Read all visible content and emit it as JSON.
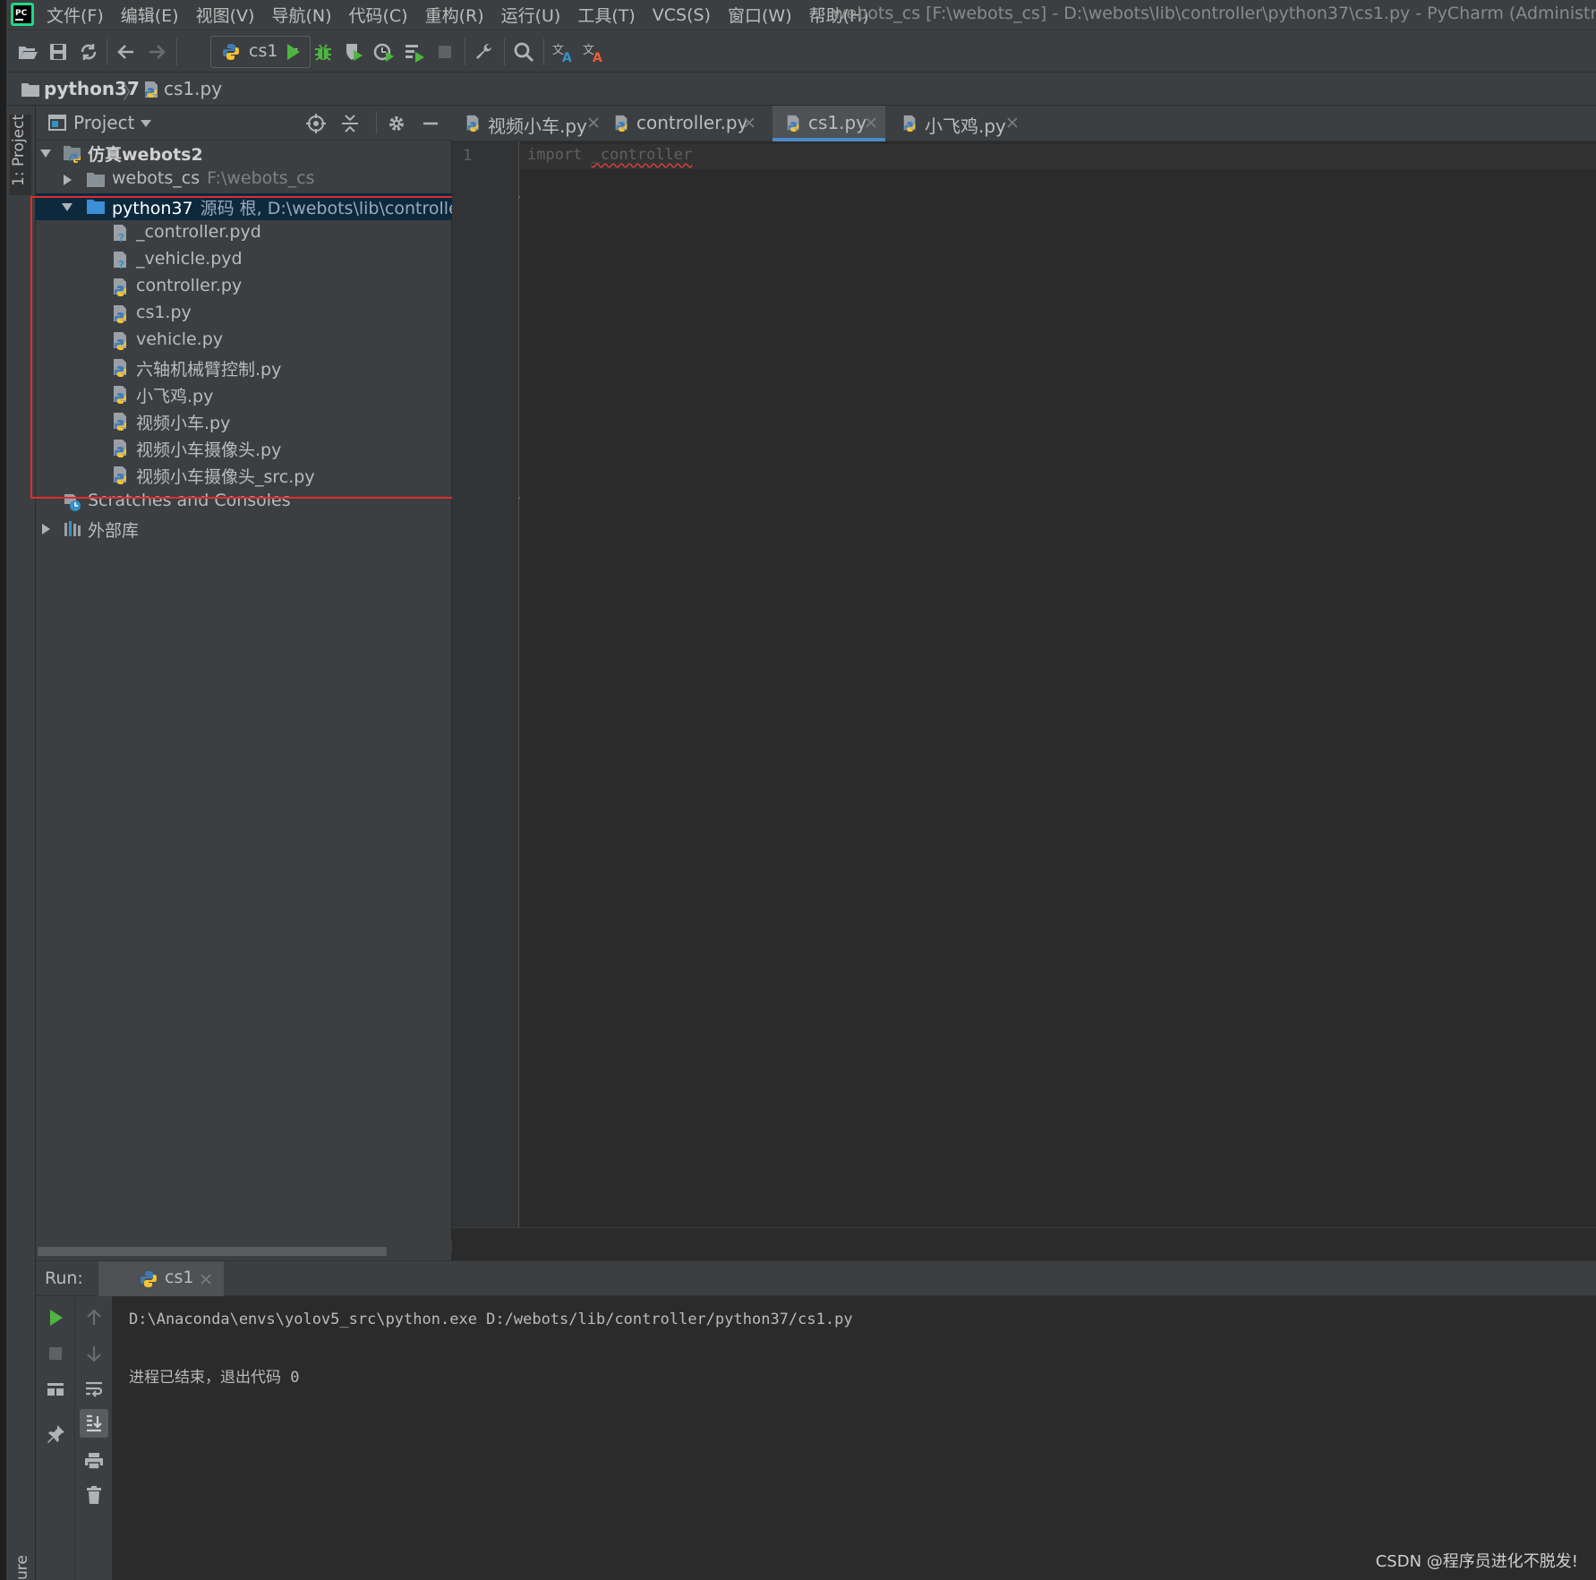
{
  "menubar": {
    "items": [
      "文件(F)",
      "编辑(E)",
      "视图(V)",
      "导航(N)",
      "代码(C)",
      "重构(R)",
      "运行(U)",
      "工具(T)",
      "VCS(S)",
      "窗口(W)",
      "帮助(H)"
    ],
    "window_title": "webots_cs [F:\\webots_cs] - D:\\webots\\lib\\controller\\python37\\cs1.py - PyCharm (Administrator)"
  },
  "toolbar": {
    "run_config": "cs1",
    "icons": [
      "open-icon",
      "save-icon",
      "sync-icon",
      "back-icon",
      "forward-icon",
      "run-icon",
      "debug-icon",
      "coverage-icon",
      "profile-icon",
      "concurrency-icon",
      "stop-icon",
      "settings-wrench-icon",
      "search-icon",
      "translate-icon",
      "translate-alt-icon"
    ]
  },
  "breadcrumb": {
    "project": "python37",
    "file": "cs1.py"
  },
  "tool_strip": {
    "project_label": "1: Project",
    "bottom_label": "ure"
  },
  "project_panel": {
    "view_label": "Project",
    "tree": [
      {
        "label": "仿真webots2",
        "hint": "",
        "icon": "project-icon",
        "level": 0,
        "arrow": "down",
        "bold": true
      },
      {
        "label": "webots_cs",
        "hint": "F:\\webots_cs",
        "icon": "folder-icon",
        "level": 1,
        "arrow": "right"
      },
      {
        "label": "python37",
        "hint": "源码 根, D:\\webots\\lib\\controller\\",
        "icon": "source-folder-icon",
        "level": 1,
        "arrow": "down",
        "selected": true
      },
      {
        "label": "_controller.pyd",
        "icon": "pyd-file-icon",
        "level": 2
      },
      {
        "label": "_vehicle.pyd",
        "icon": "pyd-file-icon",
        "level": 2
      },
      {
        "label": "controller.py",
        "icon": "python-file-icon",
        "level": 2
      },
      {
        "label": "cs1.py",
        "icon": "python-file-icon",
        "level": 2
      },
      {
        "label": "vehicle.py",
        "icon": "python-file-icon",
        "level": 2
      },
      {
        "label": "六轴机械臂控制.py",
        "icon": "python-file-icon",
        "level": 2
      },
      {
        "label": "小飞鸡.py",
        "icon": "python-file-icon",
        "level": 2
      },
      {
        "label": "视频小车.py",
        "icon": "python-file-icon",
        "level": 2
      },
      {
        "label": "视频小车摄像头.py",
        "icon": "python-file-icon",
        "level": 2
      },
      {
        "label": "视频小车摄像头_src.py",
        "icon": "python-file-icon",
        "level": 2
      },
      {
        "label": "Scratches and Consoles",
        "icon": "scratches-icon",
        "level": 0
      },
      {
        "label": "外部库",
        "icon": "library-icon",
        "level": 0,
        "arrow": "right"
      }
    ]
  },
  "editor": {
    "tabs": [
      {
        "label": "视频小车.py",
        "active": false
      },
      {
        "label": "controller.py",
        "active": false
      },
      {
        "label": "cs1.py",
        "active": true
      },
      {
        "label": "小飞鸡.py",
        "active": false
      }
    ],
    "line_number": "1",
    "code_keyword": "import",
    "code_module": "_controller"
  },
  "run_panel": {
    "label": "Run:",
    "tab": "cs1",
    "output": [
      "D:\\Anaconda\\envs\\yolov5_src\\python.exe D:/webots/lib/controller/python37/cs1.py",
      "",
      "进程已结束，退出代码 0"
    ]
  },
  "watermark": "CSDN @程序员进化不脱发!",
  "colors": {
    "background": "#2b2b2b",
    "panel": "#3c3f41",
    "selection": "#0d293e",
    "highlight_box": "#e02d2d",
    "run_green": "#4fb541",
    "tab_underline": "#4a88c7"
  }
}
